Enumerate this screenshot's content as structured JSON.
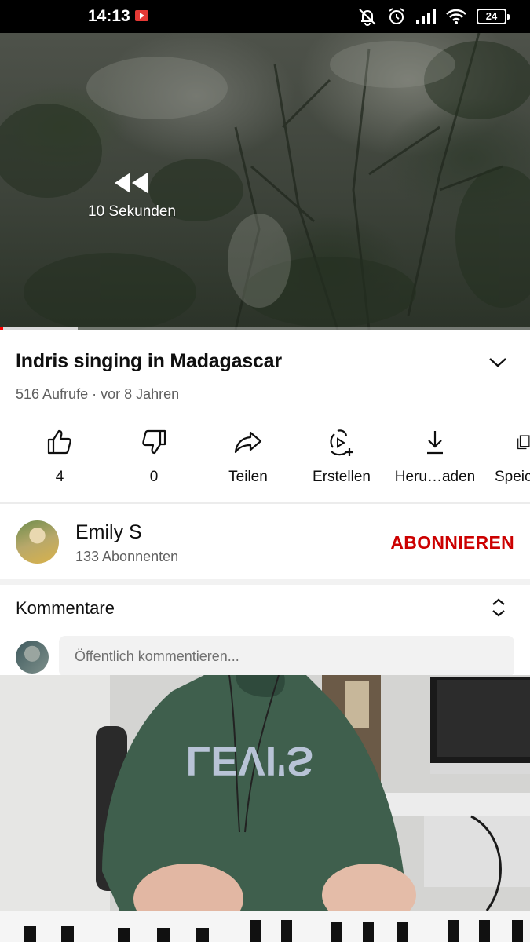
{
  "status_bar": {
    "time": "14:13",
    "battery": "24"
  },
  "video": {
    "seek_label": "10 Sekunden",
    "progress_fraction": 0.147
  },
  "details": {
    "title": "Indris singing in Madagascar",
    "meta": "516 Aufrufe · vor 8 Jahren"
  },
  "actions": [
    {
      "icon": "thumbs-up-icon",
      "label": "4"
    },
    {
      "icon": "thumbs-down-icon",
      "label": "0"
    },
    {
      "icon": "share-icon",
      "label": "Teilen"
    },
    {
      "icon": "remix-icon",
      "label": "Erstellen"
    },
    {
      "icon": "download-icon",
      "label": "Heru…aden"
    },
    {
      "icon": "save-playlist-icon",
      "label": "Speic"
    }
  ],
  "channel": {
    "name": "Emily S",
    "subscribers": "133 Abonnenten",
    "subscribe_label": "ABONNIEREN"
  },
  "comments": {
    "heading": "Kommentare",
    "placeholder": "Öffentlich kommentieren..."
  },
  "colors": {
    "brand_red": "#cc0000",
    "progress_red": "#ff0000",
    "secondary_text": "#606060"
  },
  "webcam_overlay": {
    "shirt_text": "LEVI'S"
  }
}
